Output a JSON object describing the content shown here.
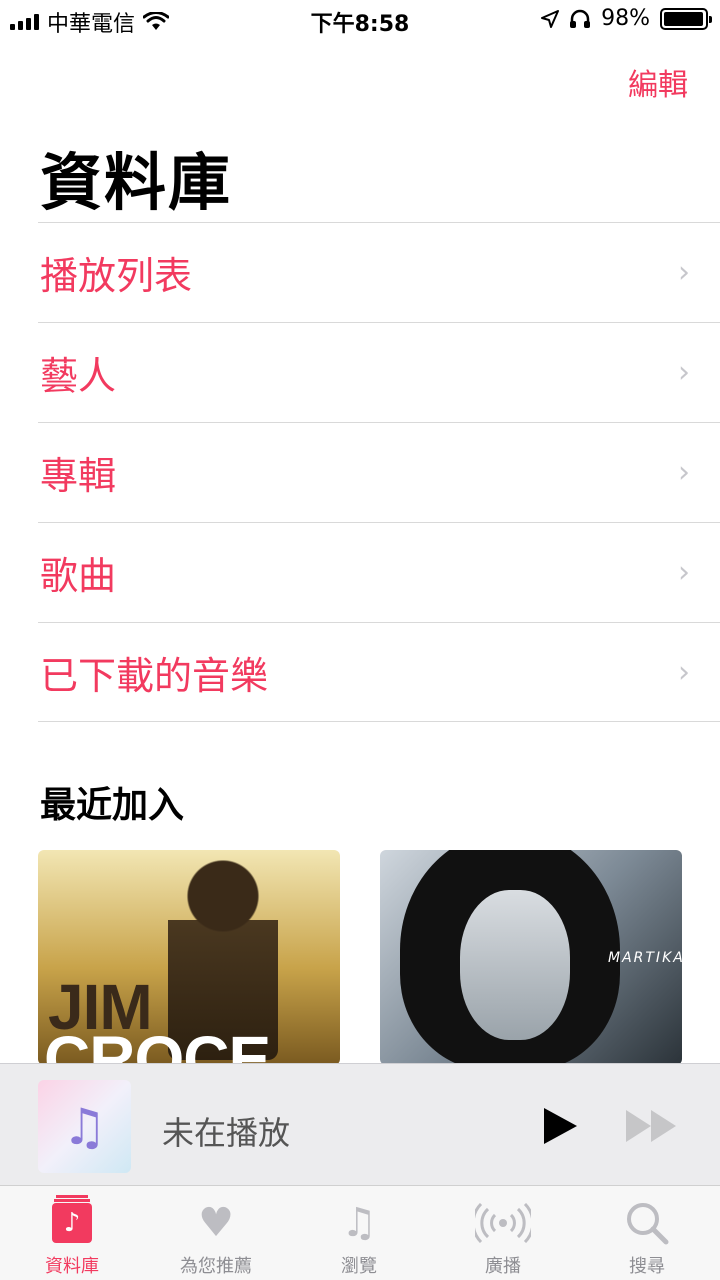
{
  "status": {
    "carrier": "中華電信",
    "time": "下午8:58",
    "battery": "98%",
    "battery_level": 0.98
  },
  "header": {
    "edit_label": "編輯",
    "title": "資料庫"
  },
  "library_items": [
    {
      "label": "播放列表"
    },
    {
      "label": "藝人"
    },
    {
      "label": "專輯"
    },
    {
      "label": "歌曲"
    },
    {
      "label": "已下載的音樂"
    }
  ],
  "recent": {
    "title": "最近加入",
    "albums": [
      {
        "cover_line1": "JIM",
        "cover_line2": "CROCE"
      },
      {
        "cover_text": "MARTIKA"
      }
    ]
  },
  "player": {
    "status": "未在播放"
  },
  "tabs": [
    {
      "label": "資料庫",
      "icon": "library-icon",
      "active": true
    },
    {
      "label": "為您推薦",
      "icon": "heart-icon"
    },
    {
      "label": "瀏覽",
      "icon": "music-note-icon"
    },
    {
      "label": "廣播",
      "icon": "radio-icon"
    },
    {
      "label": "搜尋",
      "icon": "search-icon"
    }
  ],
  "colors": {
    "accent": "#f23a5f"
  }
}
